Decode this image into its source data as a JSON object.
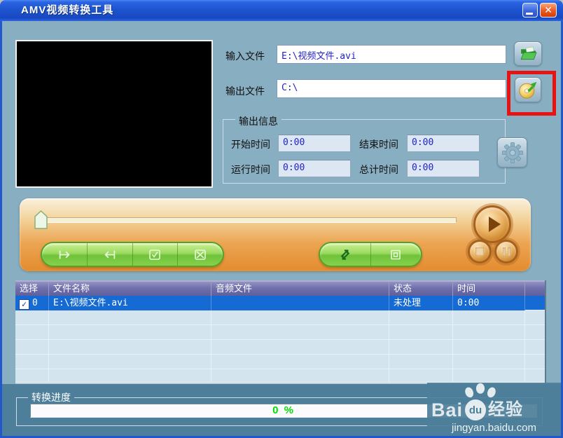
{
  "window": {
    "title": "AMV视频转换工具"
  },
  "titlebar": {
    "close_glyph": "✕"
  },
  "icons": {
    "check": "✓"
  },
  "io": {
    "input_label": "输入文件",
    "input_value": "E:\\视频文件.avi",
    "output_label": "输出文件",
    "output_value": "C:\\"
  },
  "output_info": {
    "title": "输出信息",
    "fields": [
      {
        "label": "开始时间",
        "value": "0:00"
      },
      {
        "label": "结束时间",
        "value": "0:00"
      },
      {
        "label": "运行时间",
        "value": "0:00"
      },
      {
        "label": "总计时间",
        "value": "0:00"
      }
    ]
  },
  "table": {
    "headers": [
      "选择",
      "文件名称",
      "音频文件",
      "状态",
      "时间"
    ],
    "rows": [
      {
        "index": "0",
        "checked": true,
        "file": "E:\\视频文件.avi",
        "audio": "",
        "status": "未处理",
        "time": "0:00"
      }
    ]
  },
  "progress": {
    "title": "转换进度",
    "value": "0 %"
  },
  "watermark": {
    "brand_left": "Bai",
    "brand_mid": "du",
    "brand_right": "经验",
    "url": "jingyan.baidu.com"
  },
  "colors": {
    "titlebar_blue": "#1e54d0",
    "body_upper": "#88aec1",
    "body_lower": "#4d7f9a",
    "selection_blue": "#156ad4",
    "progress_text_green": "#00dd00",
    "annotation_red": "#e81212"
  }
}
